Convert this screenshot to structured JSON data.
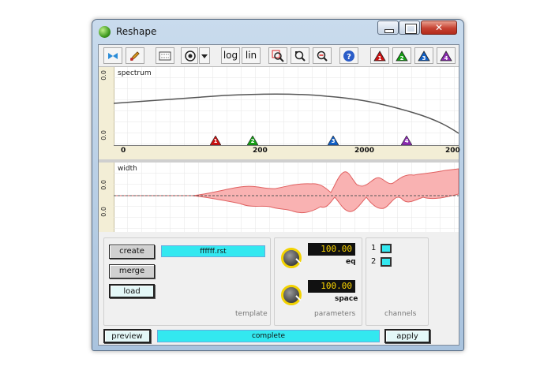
{
  "window": {
    "title": "Reshape"
  },
  "toolbar": {
    "log_label": "log",
    "lin_label": "lin",
    "icons": [
      "pin-icon",
      "pencil-icon",
      "grid-icon",
      "target-icon",
      "dropdown-icon",
      "zoom-box-icon",
      "zoom-reset-icon",
      "zoom-out-icon",
      "help-icon"
    ],
    "markers": [
      "1",
      "2",
      "3",
      "4"
    ],
    "marker_colors": [
      "#cc1111",
      "#14a014",
      "#1060c8",
      "#8a2ab0"
    ]
  },
  "spectrum": {
    "title": "spectrum",
    "side_labels": [
      "0.0",
      "0.0"
    ],
    "x_ticks": [
      "0",
      "200",
      "2000",
      "200"
    ],
    "marker_labels": [
      "1",
      "2",
      "3",
      "4"
    ]
  },
  "width": {
    "title": "width",
    "side_labels": [
      "0.0",
      "0.0"
    ]
  },
  "template": {
    "create_label": "create",
    "merge_label": "merge",
    "load_label": "load",
    "file_name": "ffffff.rst",
    "group_label": "template"
  },
  "parameters": {
    "eq_value": "100.00",
    "eq_label": "eq",
    "space_value": "100.00",
    "space_label": "space",
    "group_label": "parameters"
  },
  "channels": {
    "items": [
      {
        "label": "1"
      },
      {
        "label": "2"
      }
    ],
    "group_label": "channels"
  },
  "footer": {
    "preview_label": "preview",
    "status": "complete",
    "apply_label": "apply"
  }
}
